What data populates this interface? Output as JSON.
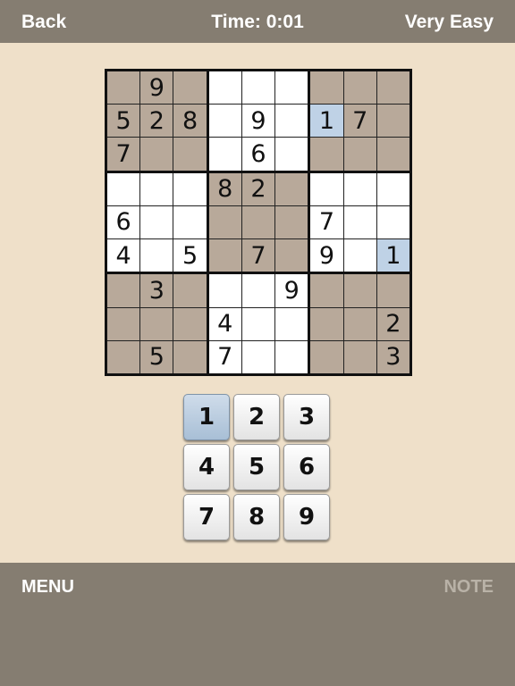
{
  "header": {
    "back_label": "Back",
    "timer": "Time: 0:01",
    "difficulty": "Very Easy"
  },
  "board": {
    "rows": [
      [
        "",
        "9",
        "",
        "",
        "",
        "",
        "",
        "",
        ""
      ],
      [
        "5",
        "2",
        "8",
        "",
        "9",
        "",
        "1",
        "7",
        ""
      ],
      [
        "7",
        "",
        "",
        "",
        "6",
        "",
        "",
        "",
        ""
      ],
      [
        "",
        "",
        "",
        "8",
        "2",
        "",
        "",
        "",
        ""
      ],
      [
        "6",
        "",
        "",
        "",
        "",
        "",
        "7",
        "",
        ""
      ],
      [
        "4",
        "",
        "5",
        "",
        "7",
        "",
        "9",
        "",
        "1"
      ],
      [
        "",
        "3",
        "",
        "",
        "",
        "9",
        "",
        "",
        ""
      ],
      [
        "",
        "",
        "",
        "4",
        "",
        "",
        "",
        "",
        "2"
      ],
      [
        "",
        "5",
        "",
        "7",
        "",
        "",
        "",
        "",
        "3"
      ]
    ],
    "highlighted_cells": [
      [
        1,
        6
      ],
      [
        5,
        8
      ]
    ],
    "colors": {
      "tan": "#b8a99a",
      "white": "#ffffff",
      "highlight": "#bfd2e6"
    }
  },
  "keypad": {
    "keys": [
      "1",
      "2",
      "3",
      "4",
      "5",
      "6",
      "7",
      "8",
      "9"
    ],
    "active_key": "1"
  },
  "footer": {
    "menu_label": "MENU",
    "note_label": "NOTE"
  }
}
